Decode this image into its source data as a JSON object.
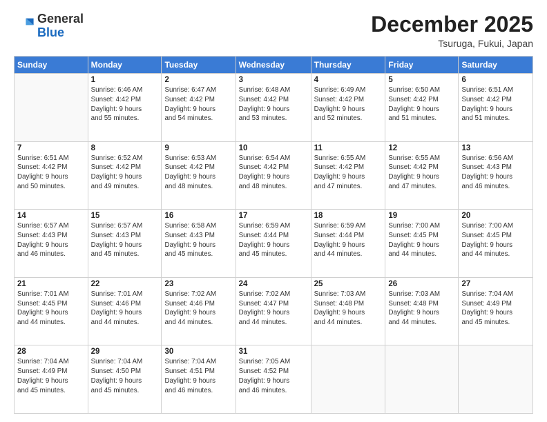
{
  "header": {
    "logo_general": "General",
    "logo_blue": "Blue",
    "month": "December 2025",
    "location": "Tsuruga, Fukui, Japan"
  },
  "days_of_week": [
    "Sunday",
    "Monday",
    "Tuesday",
    "Wednesday",
    "Thursday",
    "Friday",
    "Saturday"
  ],
  "weeks": [
    [
      {
        "day": "",
        "info": ""
      },
      {
        "day": "1",
        "info": "Sunrise: 6:46 AM\nSunset: 4:42 PM\nDaylight: 9 hours\nand 55 minutes."
      },
      {
        "day": "2",
        "info": "Sunrise: 6:47 AM\nSunset: 4:42 PM\nDaylight: 9 hours\nand 54 minutes."
      },
      {
        "day": "3",
        "info": "Sunrise: 6:48 AM\nSunset: 4:42 PM\nDaylight: 9 hours\nand 53 minutes."
      },
      {
        "day": "4",
        "info": "Sunrise: 6:49 AM\nSunset: 4:42 PM\nDaylight: 9 hours\nand 52 minutes."
      },
      {
        "day": "5",
        "info": "Sunrise: 6:50 AM\nSunset: 4:42 PM\nDaylight: 9 hours\nand 51 minutes."
      },
      {
        "day": "6",
        "info": "Sunrise: 6:51 AM\nSunset: 4:42 PM\nDaylight: 9 hours\nand 51 minutes."
      }
    ],
    [
      {
        "day": "7",
        "info": "Sunrise: 6:51 AM\nSunset: 4:42 PM\nDaylight: 9 hours\nand 50 minutes."
      },
      {
        "day": "8",
        "info": "Sunrise: 6:52 AM\nSunset: 4:42 PM\nDaylight: 9 hours\nand 49 minutes."
      },
      {
        "day": "9",
        "info": "Sunrise: 6:53 AM\nSunset: 4:42 PM\nDaylight: 9 hours\nand 48 minutes."
      },
      {
        "day": "10",
        "info": "Sunrise: 6:54 AM\nSunset: 4:42 PM\nDaylight: 9 hours\nand 48 minutes."
      },
      {
        "day": "11",
        "info": "Sunrise: 6:55 AM\nSunset: 4:42 PM\nDaylight: 9 hours\nand 47 minutes."
      },
      {
        "day": "12",
        "info": "Sunrise: 6:55 AM\nSunset: 4:42 PM\nDaylight: 9 hours\nand 47 minutes."
      },
      {
        "day": "13",
        "info": "Sunrise: 6:56 AM\nSunset: 4:43 PM\nDaylight: 9 hours\nand 46 minutes."
      }
    ],
    [
      {
        "day": "14",
        "info": "Sunrise: 6:57 AM\nSunset: 4:43 PM\nDaylight: 9 hours\nand 46 minutes."
      },
      {
        "day": "15",
        "info": "Sunrise: 6:57 AM\nSunset: 4:43 PM\nDaylight: 9 hours\nand 45 minutes."
      },
      {
        "day": "16",
        "info": "Sunrise: 6:58 AM\nSunset: 4:43 PM\nDaylight: 9 hours\nand 45 minutes."
      },
      {
        "day": "17",
        "info": "Sunrise: 6:59 AM\nSunset: 4:44 PM\nDaylight: 9 hours\nand 45 minutes."
      },
      {
        "day": "18",
        "info": "Sunrise: 6:59 AM\nSunset: 4:44 PM\nDaylight: 9 hours\nand 44 minutes."
      },
      {
        "day": "19",
        "info": "Sunrise: 7:00 AM\nSunset: 4:45 PM\nDaylight: 9 hours\nand 44 minutes."
      },
      {
        "day": "20",
        "info": "Sunrise: 7:00 AM\nSunset: 4:45 PM\nDaylight: 9 hours\nand 44 minutes."
      }
    ],
    [
      {
        "day": "21",
        "info": "Sunrise: 7:01 AM\nSunset: 4:45 PM\nDaylight: 9 hours\nand 44 minutes."
      },
      {
        "day": "22",
        "info": "Sunrise: 7:01 AM\nSunset: 4:46 PM\nDaylight: 9 hours\nand 44 minutes."
      },
      {
        "day": "23",
        "info": "Sunrise: 7:02 AM\nSunset: 4:46 PM\nDaylight: 9 hours\nand 44 minutes."
      },
      {
        "day": "24",
        "info": "Sunrise: 7:02 AM\nSunset: 4:47 PM\nDaylight: 9 hours\nand 44 minutes."
      },
      {
        "day": "25",
        "info": "Sunrise: 7:03 AM\nSunset: 4:48 PM\nDaylight: 9 hours\nand 44 minutes."
      },
      {
        "day": "26",
        "info": "Sunrise: 7:03 AM\nSunset: 4:48 PM\nDaylight: 9 hours\nand 44 minutes."
      },
      {
        "day": "27",
        "info": "Sunrise: 7:04 AM\nSunset: 4:49 PM\nDaylight: 9 hours\nand 45 minutes."
      }
    ],
    [
      {
        "day": "28",
        "info": "Sunrise: 7:04 AM\nSunset: 4:49 PM\nDaylight: 9 hours\nand 45 minutes."
      },
      {
        "day": "29",
        "info": "Sunrise: 7:04 AM\nSunset: 4:50 PM\nDaylight: 9 hours\nand 45 minutes."
      },
      {
        "day": "30",
        "info": "Sunrise: 7:04 AM\nSunset: 4:51 PM\nDaylight: 9 hours\nand 46 minutes."
      },
      {
        "day": "31",
        "info": "Sunrise: 7:05 AM\nSunset: 4:52 PM\nDaylight: 9 hours\nand 46 minutes."
      },
      {
        "day": "",
        "info": ""
      },
      {
        "day": "",
        "info": ""
      },
      {
        "day": "",
        "info": ""
      }
    ]
  ]
}
